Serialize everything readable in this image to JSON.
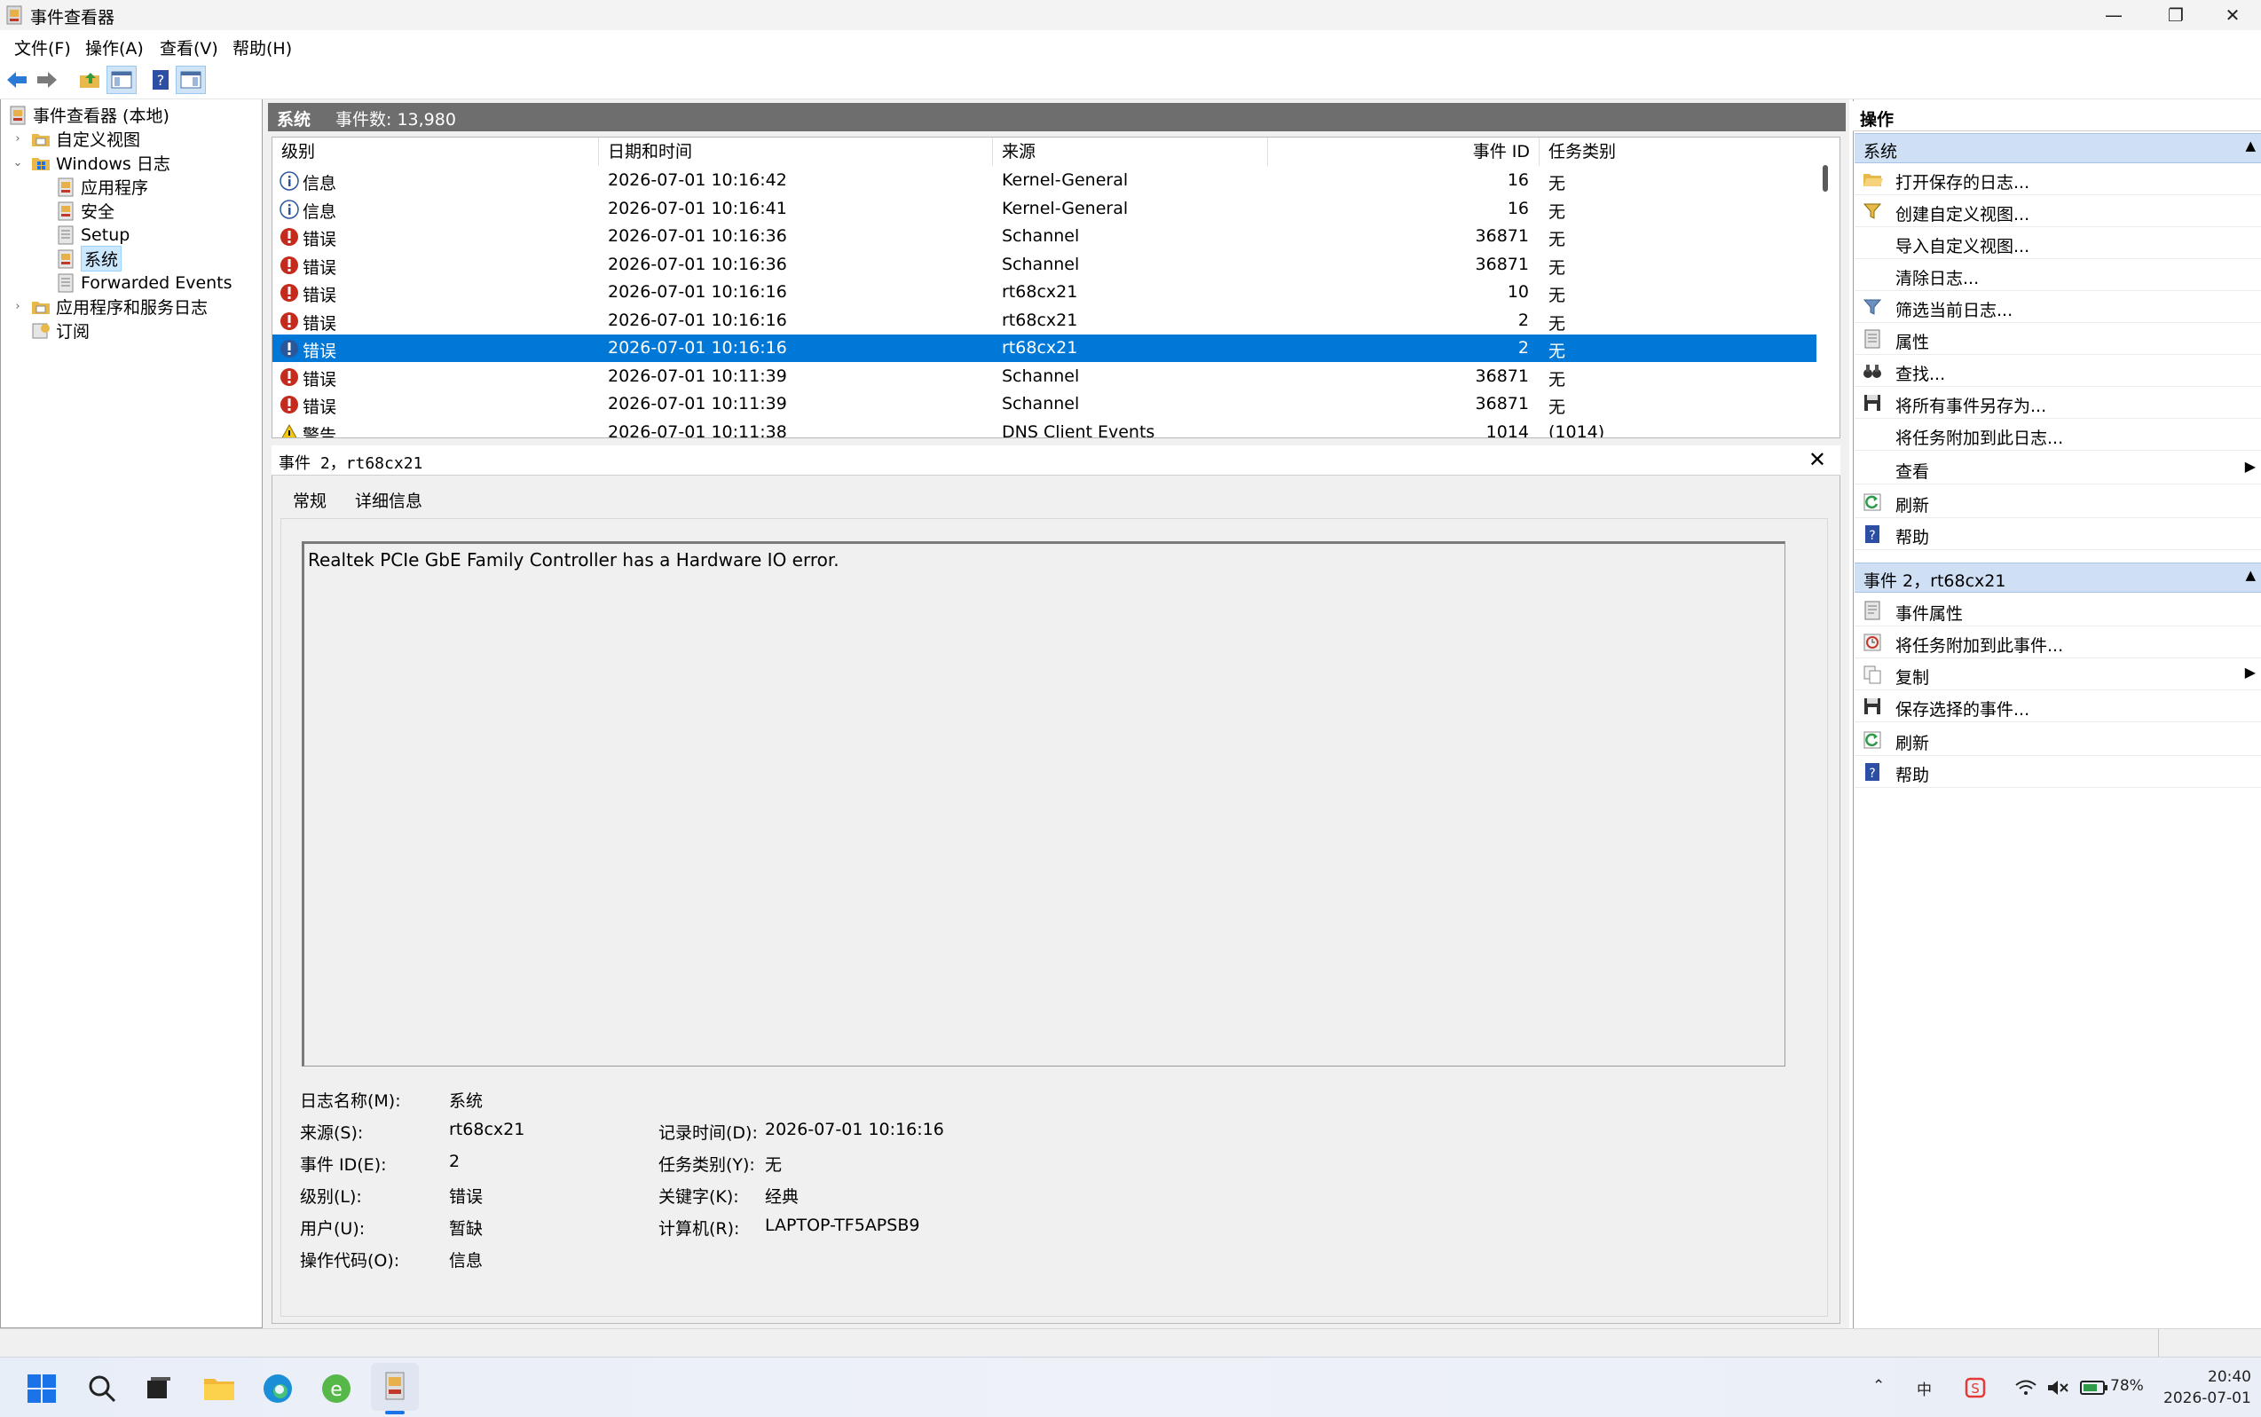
{
  "window": {
    "title": "事件查看器",
    "minimize": "—",
    "restore": "❐",
    "close": "✕"
  },
  "menu": [
    "文件(F)",
    "操作(A)",
    "查看(V)",
    "帮助(H)"
  ],
  "tree": {
    "root": "事件查看器 (本地)",
    "custom_views": "自定义视图",
    "windows_logs": "Windows 日志",
    "application": "应用程序",
    "security": "安全",
    "setup": "Setup",
    "system": "系统",
    "forwarded": "Forwarded Events",
    "apps_services": "应用程序和服务日志",
    "subscriptions": "订阅"
  },
  "middle": {
    "title": "系统",
    "count_label": "事件数: 13,980"
  },
  "columns": {
    "level": "级别",
    "datetime": "日期和时间",
    "source": "来源",
    "event_id": "事件 ID",
    "task": "任务类别"
  },
  "events": [
    {
      "level": "信息",
      "type": "info",
      "datetime": "2026-07-01 10:16:42",
      "source": "Kernel-General",
      "id": "16",
      "task": "无"
    },
    {
      "level": "信息",
      "type": "info",
      "datetime": "2026-07-01 10:16:41",
      "source": "Kernel-General",
      "id": "16",
      "task": "无"
    },
    {
      "level": "错误",
      "type": "error",
      "datetime": "2026-07-01 10:16:36",
      "source": "Schannel",
      "id": "36871",
      "task": "无"
    },
    {
      "level": "错误",
      "type": "error",
      "datetime": "2026-07-01 10:16:36",
      "source": "Schannel",
      "id": "36871",
      "task": "无"
    },
    {
      "level": "错误",
      "type": "error",
      "datetime": "2026-07-01 10:16:16",
      "source": "rt68cx21",
      "id": "10",
      "task": "无"
    },
    {
      "level": "错误",
      "type": "error",
      "datetime": "2026-07-01 10:16:16",
      "source": "rt68cx21",
      "id": "2",
      "task": "无"
    },
    {
      "level": "错误",
      "type": "error",
      "datetime": "2026-07-01 10:16:16",
      "source": "rt68cx21",
      "id": "2",
      "task": "无",
      "selected": true
    },
    {
      "level": "错误",
      "type": "error",
      "datetime": "2026-07-01 10:11:39",
      "source": "Schannel",
      "id": "36871",
      "task": "无"
    },
    {
      "level": "错误",
      "type": "error",
      "datetime": "2026-07-01 10:11:39",
      "source": "Schannel",
      "id": "36871",
      "task": "无"
    },
    {
      "level": "警告",
      "type": "warning",
      "datetime": "2026-07-01 10:11:38",
      "source": "DNS Client Events",
      "id": "1014",
      "task": "(1014)"
    }
  ],
  "detail": {
    "header": "事件 2，rt68cx21",
    "tabs": [
      "常规",
      "详细信息"
    ],
    "message": "Realtek PCIe GbE Family Controller has a Hardware IO error.",
    "fields": {
      "log_name_label": "日志名称(M):",
      "log_name": "系统",
      "source_label": "来源(S):",
      "source": "rt68cx21",
      "logged_label": "记录时间(D):",
      "logged": "2026-07-01 10:16:16",
      "event_id_label": "事件 ID(E):",
      "event_id": "2",
      "task_label": "任务类别(Y):",
      "task": "无",
      "level_label": "级别(L):",
      "level": "错误",
      "keywords_label": "关键字(K):",
      "keywords": "经典",
      "user_label": "用户(U):",
      "user": "暂缺",
      "computer_label": "计算机(R):",
      "computer": "LAPTOP-TF5APSB9",
      "opcode_label": "操作代码(O):",
      "opcode": "信息"
    }
  },
  "actions": {
    "header": "操作",
    "section1": "系统",
    "items1": [
      "打开保存的日志...",
      "创建自定义视图...",
      "导入自定义视图...",
      "清除日志...",
      "筛选当前日志...",
      "属性",
      "查找...",
      "将所有事件另存为...",
      "将任务附加到此日志...",
      "查看",
      "刷新",
      "帮助"
    ],
    "section2": "事件 2，rt68cx21",
    "items2": [
      "事件属性",
      "将任务附加到此事件...",
      "复制",
      "保存选择的事件...",
      "刷新",
      "帮助"
    ]
  },
  "taskbar": {
    "battery": "78%",
    "time": "20:40",
    "date": "2026-07-01",
    "ime": "中"
  },
  "colors": {
    "selection": "#0078d7",
    "error": "#c42b1c",
    "info": "#2b579a",
    "warning": "#f2c811",
    "section_header": "#cfe0f5"
  }
}
